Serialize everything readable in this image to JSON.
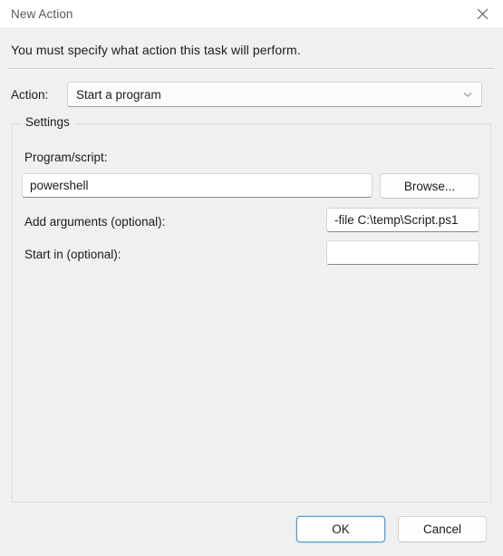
{
  "window": {
    "title": "New Action",
    "close_icon": "close-icon"
  },
  "instruction": "You must specify what action this task will perform.",
  "action_row": {
    "label": "Action:",
    "selected_value": "Start a program",
    "chevron_icon": "chevron-down-icon",
    "options": [
      "Start a program"
    ]
  },
  "settings_group": {
    "legend": "Settings",
    "fields": {
      "program": {
        "label": "Program/script:",
        "value": "powershell",
        "placeholder": ""
      },
      "arguments": {
        "label": "Add arguments (optional):",
        "value": "-file C:\\temp\\Script.ps1",
        "placeholder": ""
      },
      "start_in": {
        "label": "Start in (optional):",
        "value": "",
        "placeholder": ""
      }
    },
    "browse_button": "Browse..."
  },
  "footer": {
    "ok_label": "OK",
    "cancel_label": "Cancel"
  },
  "colors": {
    "accent": "#4f9ed4",
    "window_bg": "#f0f0f0",
    "titlebar_bg": "#ffffff",
    "text": "#1b1b1b",
    "title_text": "#5a5a5a"
  }
}
